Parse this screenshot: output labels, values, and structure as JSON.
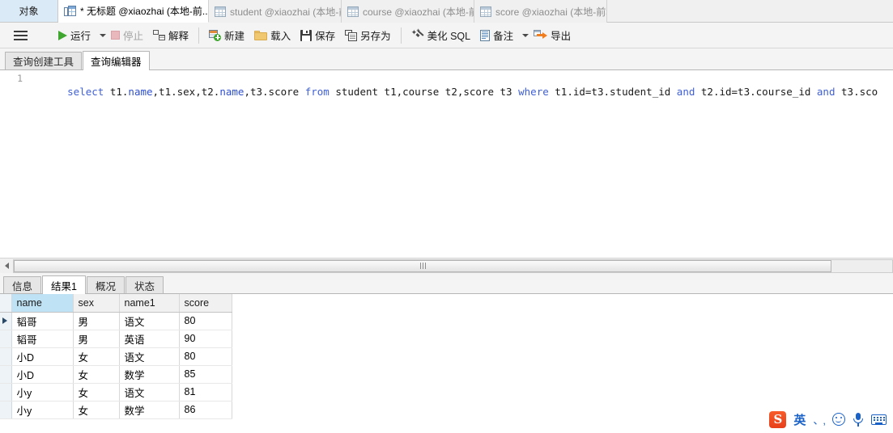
{
  "topbar": {
    "object_tab_label": "对象",
    "tabs": [
      {
        "label": "* 无标题 @xiaozhai (本地-前...",
        "icon": "query-icon",
        "active": true
      },
      {
        "label": "student @xiaozhai (本地-前...",
        "icon": "table-icon",
        "active": false
      },
      {
        "label": "course @xiaozhai (本地-前程...",
        "icon": "table-icon",
        "active": false
      },
      {
        "label": "score @xiaozhai (本地-前程...",
        "icon": "table-icon",
        "active": false
      }
    ]
  },
  "toolbar": {
    "menu_icon": "hamburger-icon",
    "run_label": "运行",
    "stop_label": "停止",
    "explain_label": "解释",
    "new_label": "新建",
    "load_label": "载入",
    "save_label": "保存",
    "save_as_label": "另存为",
    "beautify_label": "美化 SQL",
    "note_label": "备注",
    "export_label": "导出"
  },
  "subtabs": [
    {
      "label": "查询创建工具",
      "active": false
    },
    {
      "label": "查询编辑器",
      "active": true
    }
  ],
  "editor": {
    "line_number": "1",
    "sql_segments": [
      {
        "text": "select ",
        "type": "kw"
      },
      {
        "text": "t1.",
        "type": "plain"
      },
      {
        "text": "name",
        "type": "fld"
      },
      {
        "text": ",t1.sex,t2.",
        "type": "plain"
      },
      {
        "text": "name",
        "type": "fld"
      },
      {
        "text": ",t3.score ",
        "type": "plain"
      },
      {
        "text": "from ",
        "type": "kw"
      },
      {
        "text": "student t1,course t2,score t3 ",
        "type": "plain"
      },
      {
        "text": "where ",
        "type": "kw"
      },
      {
        "text": "t1.id=t3.student_id ",
        "type": "plain"
      },
      {
        "text": "and ",
        "type": "kw"
      },
      {
        "text": "t2.id=t3.course_id ",
        "type": "plain"
      },
      {
        "text": "and ",
        "type": "kw"
      },
      {
        "text": "t3.sco",
        "type": "plain"
      }
    ]
  },
  "scrollbar": {
    "orientation": "horizontal"
  },
  "result_tabs": [
    {
      "label": "信息",
      "active": false
    },
    {
      "label": "结果1",
      "active": true
    },
    {
      "label": "概况",
      "active": false
    },
    {
      "label": "状态",
      "active": false
    }
  ],
  "result_grid": {
    "columns": [
      "name",
      "sex",
      "name1",
      "score"
    ],
    "selected_column": "name",
    "current_row_index": 0,
    "rows": [
      {
        "name": "韬哥",
        "sex": "男",
        "name1": "语文",
        "score": "80"
      },
      {
        "name": "韬哥",
        "sex": "男",
        "name1": "英语",
        "score": "90"
      },
      {
        "name": "小D",
        "sex": "女",
        "name1": "语文",
        "score": "80"
      },
      {
        "name": "小D",
        "sex": "女",
        "name1": "数学",
        "score": "85"
      },
      {
        "name": "小y",
        "sex": "女",
        "name1": "语文",
        "score": "81"
      },
      {
        "name": "小y",
        "sex": "女",
        "name1": "数学",
        "score": "86"
      }
    ]
  },
  "ime": {
    "logo": "S",
    "mode_label": "英",
    "punctuation_icon": "punctuation-toggle-icon",
    "emoji_icon": "emoji-icon",
    "voice_icon": "microphone-icon",
    "keyboard_icon": "soft-keyboard-icon"
  },
  "colors": {
    "accent_blue": "#bfe2f4",
    "tab_active_bg": "#ffffff",
    "object_tab_bg": "#dbeaf7",
    "keyword": "#3f5fd6",
    "field": "#2e4fd0",
    "run_green": "#3fa72f",
    "export_orange": "#f07d1e",
    "ime_blue": "#1a62c8"
  }
}
